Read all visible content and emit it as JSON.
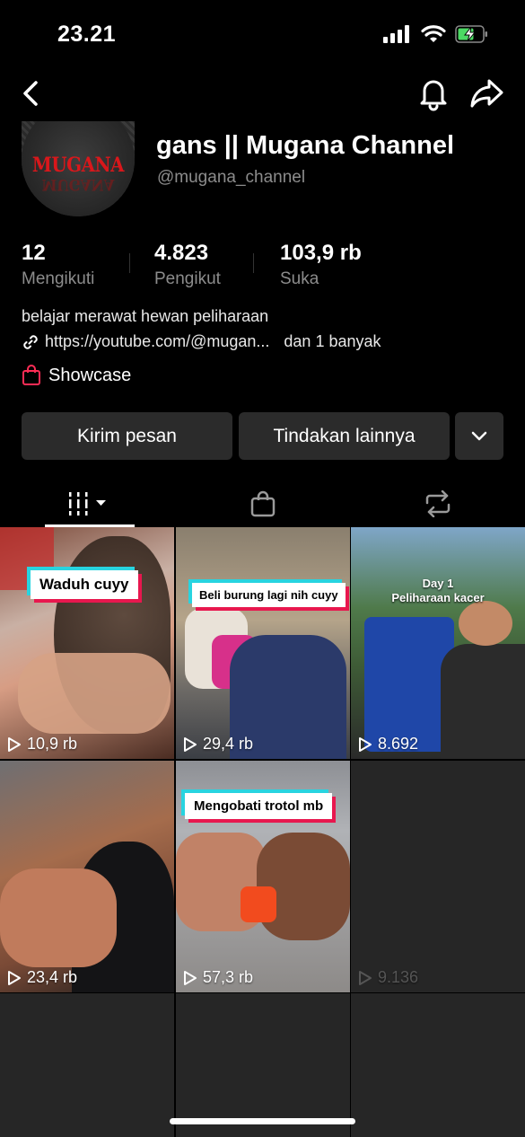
{
  "status_bar": {
    "time": "23.21"
  },
  "profile": {
    "name": "gans || Mugana Channel",
    "handle": "@mugana_channel",
    "avatar_text": "MUGANA",
    "stats": [
      {
        "value": "12",
        "label": "Mengikuti"
      },
      {
        "value": "4.823",
        "label": "Pengikut"
      },
      {
        "value": "103,9 rb",
        "label": "Suka"
      }
    ],
    "bio": "belajar merawat hewan peliharaan",
    "link": "https://youtube.com/@mugan...",
    "link_more": "dan 1 banyak",
    "showcase": "Showcase"
  },
  "actions": {
    "message": "Kirim pesan",
    "more_actions": "Tindakan lainnya"
  },
  "videos": [
    {
      "views": "10,9 rb",
      "caption": "Waduh cuyy"
    },
    {
      "views": "29,4 rb",
      "caption": "Beli burung lagi nih cuyy"
    },
    {
      "views": "8.692",
      "overlay_line1": "Day 1",
      "overlay_line2": "Peliharaan kacer"
    },
    {
      "views": "23,4 rb"
    },
    {
      "views": "57,3 rb",
      "caption": "Mengobati trotol mb"
    },
    {
      "views": "9.136"
    }
  ],
  "colors": {
    "accent_red": "#e8174e",
    "accent_cyan": "#28d4e0",
    "button_bg": "#2b2b2b"
  }
}
